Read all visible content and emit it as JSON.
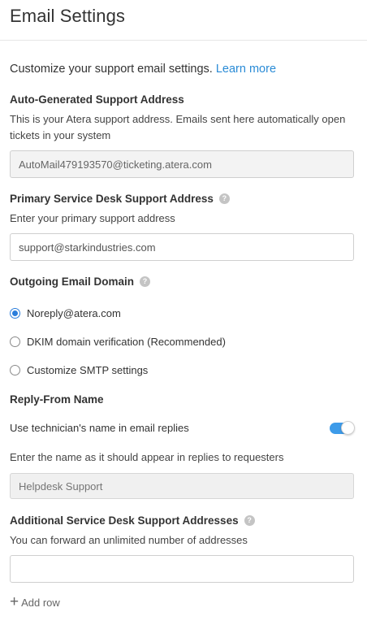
{
  "header": {
    "title": "Email Settings"
  },
  "intro": {
    "text": "Customize your support email settings.",
    "link": "Learn more"
  },
  "auto_address": {
    "title": "Auto-Generated Support Address",
    "description": "This is your Atera support address. Emails sent here automatically open tickets in your system",
    "value": "AutoMail479193570@ticketing.atera.com"
  },
  "primary_address": {
    "title": "Primary Service Desk Support Address",
    "help": "?",
    "description": "Enter your primary support address",
    "value": "support@starkindustries.com"
  },
  "outgoing_domain": {
    "title": "Outgoing Email Domain",
    "help": "?",
    "options": [
      {
        "label": "Noreply@atera.com",
        "checked": true
      },
      {
        "label": "DKIM domain verification (Recommended)",
        "checked": false
      },
      {
        "label": "Customize SMTP settings",
        "checked": false
      }
    ]
  },
  "reply_from": {
    "title": "Reply-From Name",
    "toggle_label": "Use technician's name in email replies",
    "toggle_on": true,
    "name_description": "Enter the name as it should appear in replies to requesters",
    "name_placeholder": "Helpdesk Support"
  },
  "additional_addresses": {
    "title": "Additional Service Desk Support Addresses",
    "help": "?",
    "description": "You can forward an unlimited number of addresses",
    "value": "",
    "add_row_label": "Add row"
  },
  "colors": {
    "accent": "#2a8bd6",
    "toggle_on": "#3d9be9",
    "radio_checked": "#2a7ddb"
  }
}
